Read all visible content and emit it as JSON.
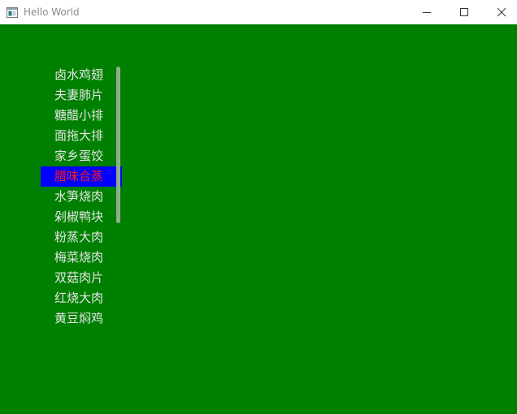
{
  "window": {
    "title": "Hello World"
  },
  "menu": {
    "items": [
      {
        "label": "卤水鸡翅"
      },
      {
        "label": "夫妻肺片"
      },
      {
        "label": "糖醋小排"
      },
      {
        "label": "面拖大排"
      },
      {
        "label": "家乡蛋饺"
      },
      {
        "label": "腊味合蒸"
      },
      {
        "label": "水笋烧肉"
      },
      {
        "label": "剁椒鸭块"
      },
      {
        "label": "粉蒸大肉"
      },
      {
        "label": "梅菜烧肉"
      },
      {
        "label": "双菇肉片"
      },
      {
        "label": "红烧大肉"
      },
      {
        "label": "黄豆焖鸡"
      }
    ],
    "selected_index": 5
  },
  "colors": {
    "background": "#008000",
    "item_text": "#e6e6e6",
    "selected_background": "#0000ff",
    "selected_text": "#ff1a1a",
    "scrollbar": "#8fae8f"
  },
  "icons": {
    "app": "window-app-icon",
    "minimize": "minimize-icon",
    "maximize": "maximize-icon",
    "close": "close-icon"
  }
}
